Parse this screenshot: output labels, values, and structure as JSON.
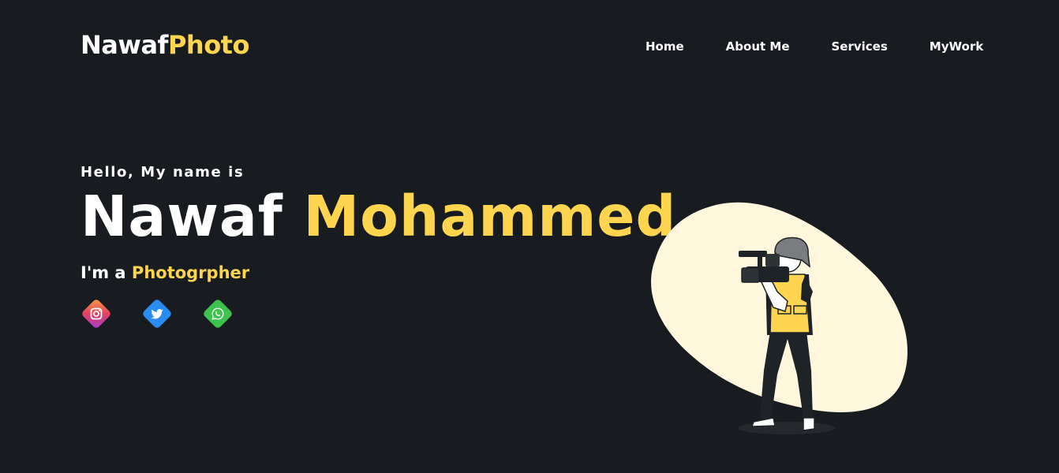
{
  "header": {
    "logo_main": "Nawaf",
    "logo_accent": "Photo",
    "nav": [
      {
        "label": "Home"
      },
      {
        "label": "About Me"
      },
      {
        "label": "Services"
      },
      {
        "label": "MyWork"
      }
    ]
  },
  "hero": {
    "greeting": "Hello, My name is",
    "first_name": "Nawaf",
    "last_name": "Mohammed",
    "role_prefix": "I'm a",
    "role": "Photogrpher"
  },
  "socials": [
    {
      "icon": "instagram-icon",
      "color": "#e4405f"
    },
    {
      "icon": "twitter-icon",
      "color": "#2a8cf0"
    },
    {
      "icon": "whatsapp-icon",
      "color": "#3ec24f"
    }
  ],
  "colors": {
    "background": "#181b1f",
    "accent": "#ffd54f",
    "text": "#ffffff",
    "blob": "#fff8dd"
  }
}
